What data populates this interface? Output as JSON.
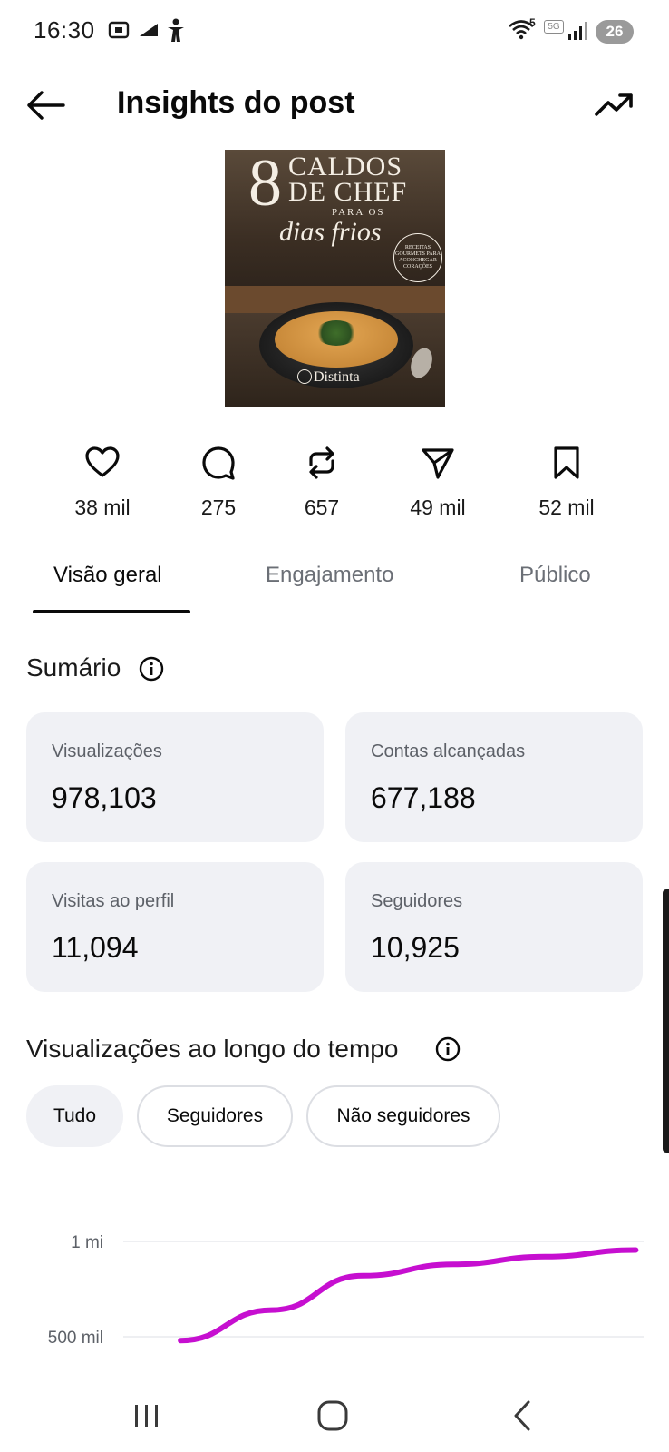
{
  "status_bar": {
    "time": "16:30",
    "wifi_badge": "5",
    "network_label": "5G",
    "battery": "26"
  },
  "header": {
    "title": "Insights do post"
  },
  "post": {
    "thumbnail": {
      "number": "8",
      "title_line1": "CALDOS",
      "title_line2": "DE CHEF",
      "subtitle": "PARA OS",
      "script": "dias frios",
      "badge": "RECEITAS GOURMETS PARA ACONCHEGAR CORAÇÕES",
      "brand": "Distinta"
    }
  },
  "stats": {
    "likes": "38 mil",
    "comments": "275",
    "reposts": "657",
    "shares": "49 mil",
    "saves": "52 mil"
  },
  "tabs": [
    {
      "label": "Visão geral",
      "active": true
    },
    {
      "label": "Engajamento",
      "active": false
    },
    {
      "label": "Público",
      "active": false
    }
  ],
  "summary": {
    "title": "Sumário",
    "cards": [
      {
        "label": "Visualizações",
        "value": "978,103"
      },
      {
        "label": "Contas alcançadas",
        "value": "677,188"
      },
      {
        "label": "Visitas ao perfil",
        "value": "11,094"
      },
      {
        "label": "Seguidores",
        "value": "10,925"
      }
    ]
  },
  "views_over_time": {
    "title": "Visualizações ao longo do tempo",
    "filters": [
      {
        "label": "Tudo",
        "selected": true
      },
      {
        "label": "Seguidores",
        "selected": false
      },
      {
        "label": "Não seguidores",
        "selected": false
      }
    ]
  },
  "colors": {
    "accent_line": "#c60fd0",
    "card_bg": "#f0f1f5",
    "muted_text": "#6b6f76"
  },
  "chart_data": {
    "type": "line",
    "y_tick_labels": [
      "1 mi",
      "500 mil"
    ],
    "y_ticks": [
      1000000,
      500000
    ],
    "ylim": [
      500000,
      1000000
    ],
    "series": [
      {
        "x": [
          0,
          0.2,
          0.4,
          0.6,
          0.8,
          1.0
        ],
        "values": [
          480000,
          640000,
          820000,
          880000,
          920000,
          955000
        ]
      }
    ],
    "grid": true
  }
}
